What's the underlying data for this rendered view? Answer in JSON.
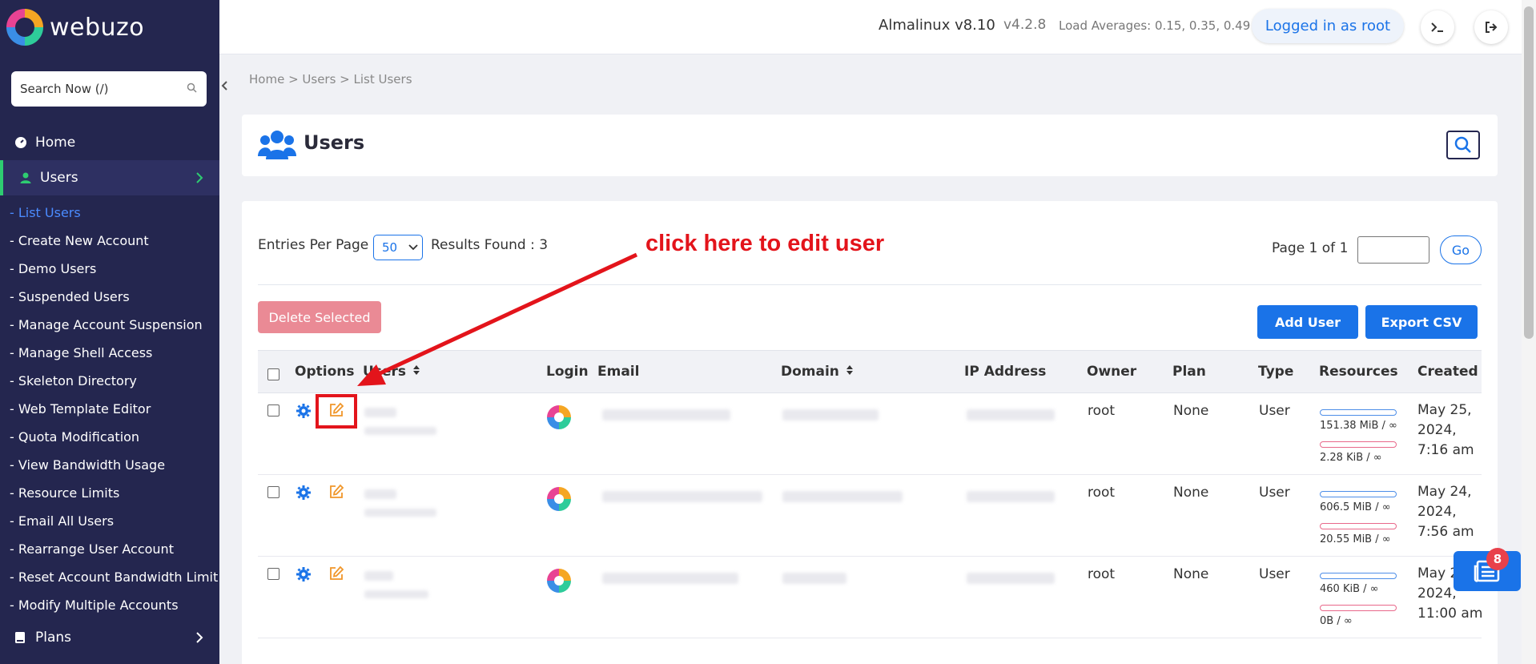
{
  "app": {
    "logo_text": "webuzo"
  },
  "topbar": {
    "os": "Almalinux v8.10",
    "version": "v4.2.8",
    "load": "Load Averages: 0.15, 0.35, 0.49",
    "logged_in": "Logged in as root",
    "terminal_icon": "terminal-icon",
    "logout_icon": "logout-icon"
  },
  "sidebar": {
    "search_placeholder": "Search Now (/)",
    "home": "Home",
    "users": "Users",
    "plans": "Plans",
    "sub_items": [
      "- List Users",
      "- Create New Account",
      "- Demo Users",
      "- Suspended Users",
      "- Manage Account Suspension",
      "- Manage Shell Access",
      "- Skeleton Directory",
      "- Web Template Editor",
      "- Quota Modification",
      "- View Bandwidth Usage",
      "- Resource Limits",
      "- Email All Users",
      "- Rearrange User Account",
      "- Reset Account Bandwidth Limit",
      "- Modify Multiple Accounts"
    ]
  },
  "breadcrumb": "Home > Users > List Users",
  "page": {
    "title": "Users"
  },
  "controls": {
    "entries_label": "Entries Per Page",
    "entries_value": "50",
    "results": "Results Found : 3",
    "page_text": "Page 1 of 1",
    "go": "Go",
    "delete_selected": "Delete Selected",
    "add_user": "Add User",
    "export_csv": "Export CSV"
  },
  "table": {
    "headers": [
      "Options",
      "Users",
      "Login",
      "Email",
      "Domain",
      "IP Address",
      "Owner",
      "Plan",
      "Type",
      "Resources",
      "Created"
    ],
    "rows": [
      {
        "owner": "root",
        "plan": "None",
        "type": "User",
        "disk": "151.38 MiB / ∞",
        "bw": "2.28 KiB / ∞",
        "created": "May 25, 2024, 7:16 am",
        "disk_fill": 0,
        "bw_fill": 0
      },
      {
        "owner": "root",
        "plan": "None",
        "type": "User",
        "disk": "606.5 MiB / ∞",
        "bw": "20.55 MiB / ∞",
        "created": "May 24, 2024, 7:56 am",
        "disk_fill": 0,
        "bw_fill": 0
      },
      {
        "owner": "root",
        "plan": "None",
        "type": "User",
        "disk": "460 KiB / ∞",
        "bw": "0B / ∞",
        "created": "May 2 2024, 11:00 am",
        "disk_fill": 0,
        "bw_fill": 0
      }
    ]
  },
  "annotation": {
    "text": "click here to edit user",
    "color": "#e3141b"
  },
  "notifications": {
    "count": "8"
  },
  "colors": {
    "sidebar": "#24264f",
    "accent": "#1a73e8",
    "active_link": "#4b8bff",
    "success": "#2ecc71",
    "delete": "#ea8a95"
  }
}
